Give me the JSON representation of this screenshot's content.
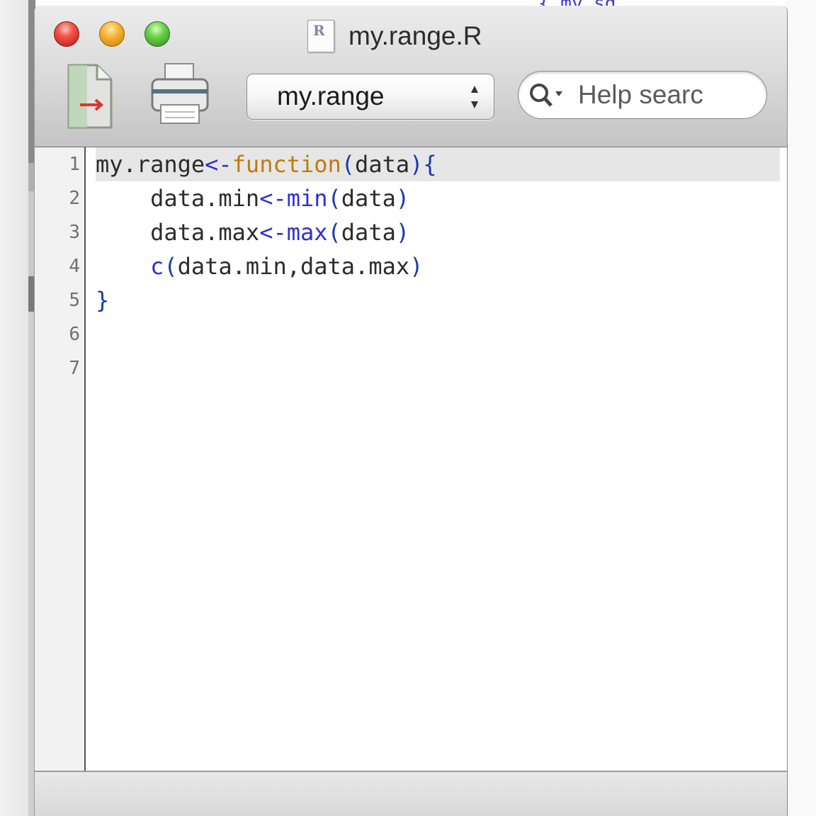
{
  "window": {
    "title": "my.range.R",
    "file_icon_letter": "R"
  },
  "toolbar": {
    "source_button": "source-icon",
    "print_button": "print-icon",
    "function_popup": {
      "selected": "my.range"
    },
    "help_search": {
      "placeholder": "Help searc"
    }
  },
  "background": {
    "peek_text": "{ my.sd"
  },
  "editor": {
    "line_numbers": [
      "1",
      "2",
      "3",
      "4",
      "5",
      "6",
      "7"
    ],
    "current_line": 1,
    "lines": [
      {
        "tokens": [
          {
            "t": "my.range",
            "c": "fn"
          },
          {
            "t": "<-",
            "c": "op"
          },
          {
            "t": "function",
            "c": "kw"
          },
          {
            "t": "(",
            "c": "br"
          },
          {
            "t": "data",
            "c": "fn"
          },
          {
            "t": ")",
            "c": "br"
          },
          {
            "t": "{",
            "c": "br"
          }
        ]
      },
      {
        "indent": "    ",
        "tokens": [
          {
            "t": "data.min",
            "c": "fn"
          },
          {
            "t": "<-",
            "c": "op"
          },
          {
            "t": "min",
            "c": "op"
          },
          {
            "t": "(",
            "c": "br"
          },
          {
            "t": "data",
            "c": "fn"
          },
          {
            "t": ")",
            "c": "br"
          }
        ]
      },
      {
        "indent": "    ",
        "tokens": [
          {
            "t": "data.max",
            "c": "fn"
          },
          {
            "t": "<-",
            "c": "op"
          },
          {
            "t": "max",
            "c": "op"
          },
          {
            "t": "(",
            "c": "br"
          },
          {
            "t": "data",
            "c": "fn"
          },
          {
            "t": ")",
            "c": "br"
          }
        ]
      },
      {
        "indent": "    ",
        "tokens": [
          {
            "t": "c",
            "c": "op"
          },
          {
            "t": "(",
            "c": "br"
          },
          {
            "t": "data.min,data.max",
            "c": "fn"
          },
          {
            "t": ")",
            "c": "br"
          }
        ]
      },
      {
        "tokens": [
          {
            "t": "}",
            "c": "br"
          }
        ]
      },
      {
        "tokens": []
      },
      {
        "tokens": []
      }
    ]
  },
  "colors": {
    "keyword": "#c17a09",
    "operator": "#2f2fd6",
    "bracket": "#1a3aa8",
    "current_line_highlight": "#e6e6e6"
  }
}
